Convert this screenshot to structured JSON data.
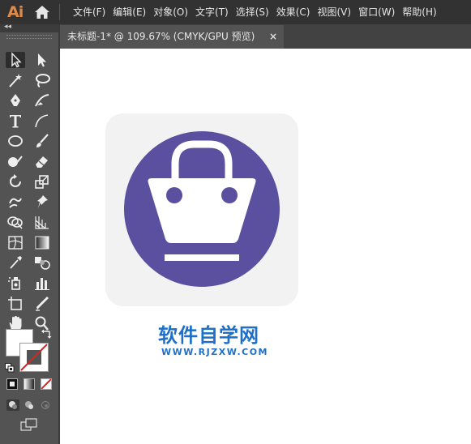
{
  "app": {
    "logo_text": "Ai"
  },
  "menu": {
    "items": [
      "文件(F)",
      "编辑(E)",
      "对象(O)",
      "文字(T)",
      "选择(S)",
      "效果(C)",
      "视图(V)",
      "窗口(W)",
      "帮助(H)"
    ]
  },
  "document_tab": {
    "title": "未标题-1* @ 109.67% (CMYK/GPU 预览)",
    "close_glyph": "×"
  },
  "tool_panel": {
    "collapse_glyph": "◂◂",
    "fill_color": "#ffffff",
    "stroke_color": "none"
  },
  "artwork": {
    "background_color": "#f2f2f2",
    "circle_color": "#5b4fa0",
    "icon_color": "#ffffff",
    "icon": "shopping-basket-icon"
  },
  "watermark": {
    "title": "软件自学网",
    "url": "WWW.RJZXW.COM"
  }
}
